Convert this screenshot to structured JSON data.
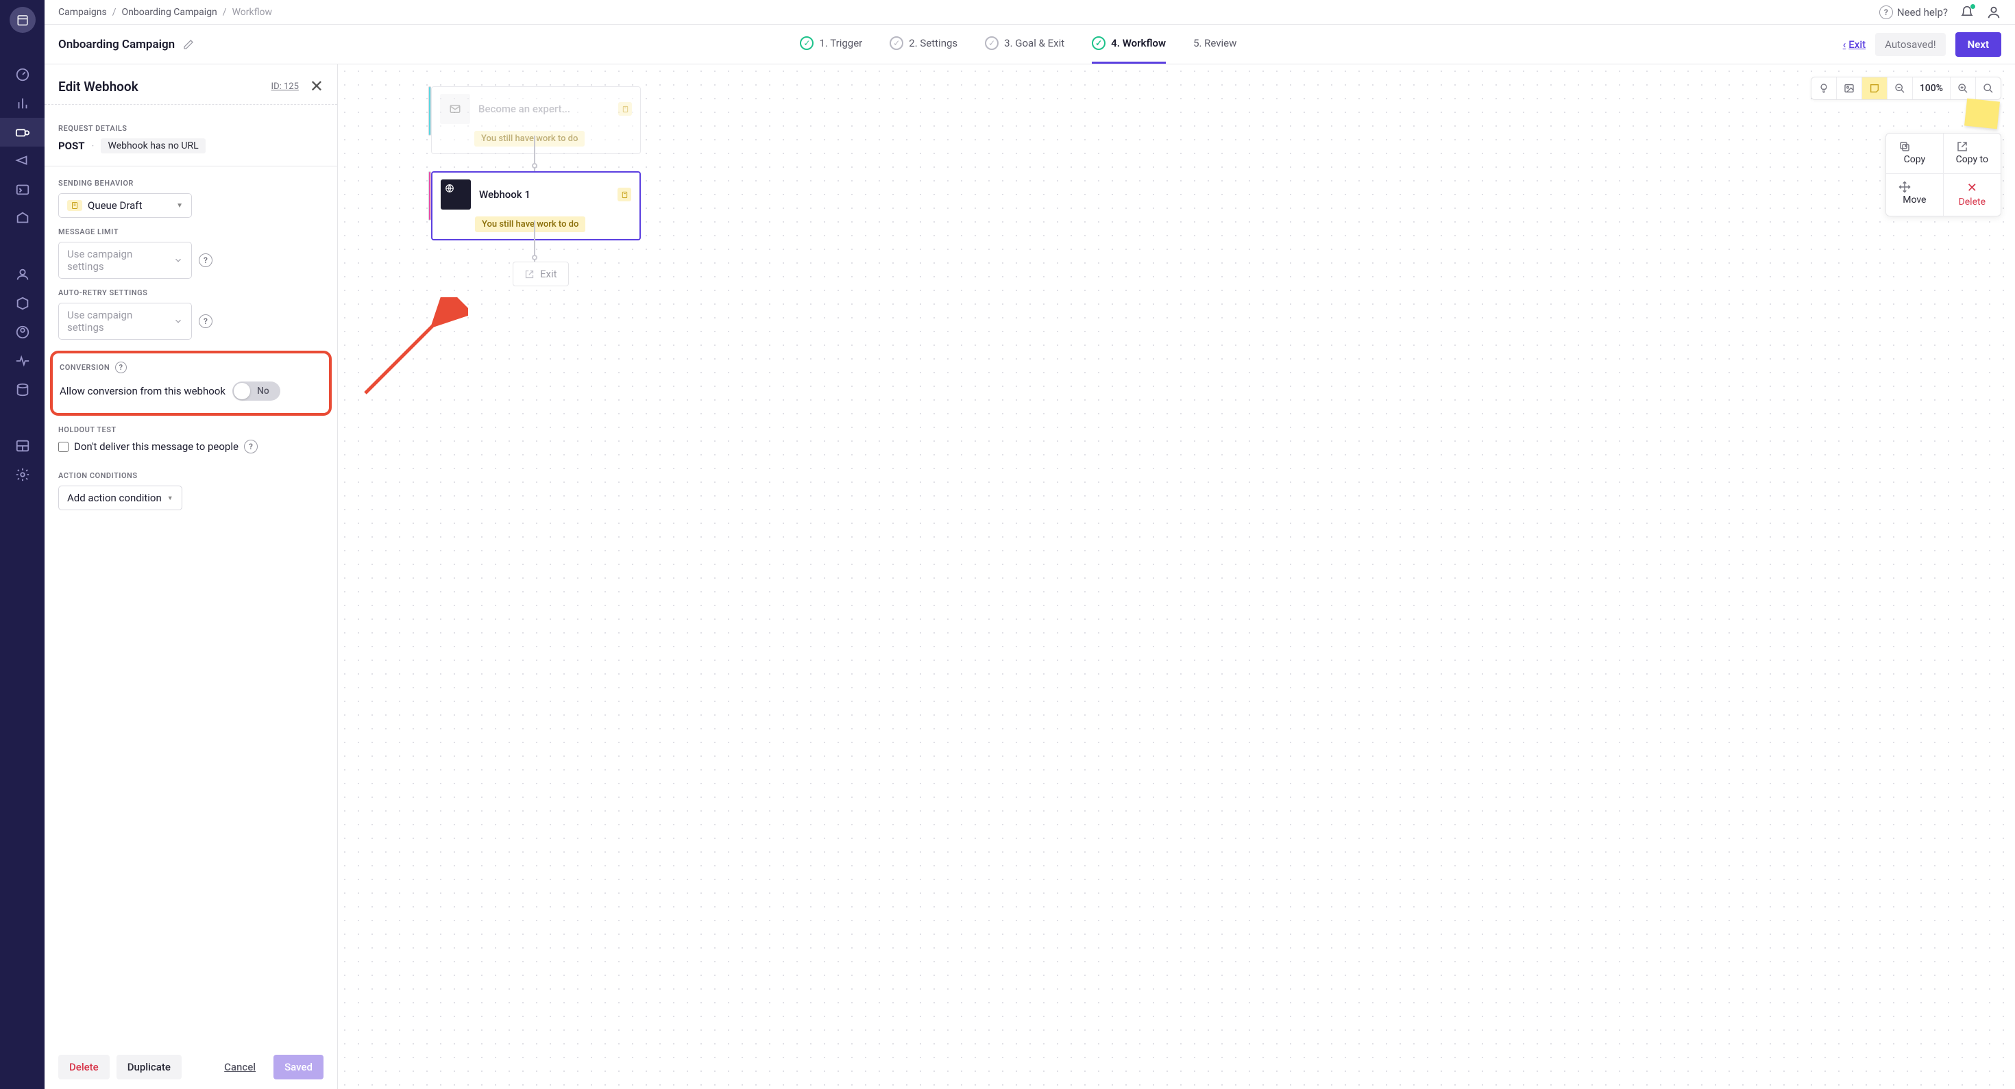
{
  "breadcrumb": {
    "a": "Campaigns",
    "b": "Onboarding Campaign",
    "c": "Workflow"
  },
  "topbar": {
    "help": "Need help?"
  },
  "header": {
    "title": "Onboarding Campaign",
    "steps": {
      "trigger": "1. Trigger",
      "settings": "2. Settings",
      "goal": "3. Goal & Exit",
      "workflow": "4. Workflow",
      "review": "5. Review"
    },
    "exit": "Exit",
    "autosaved": "Autosaved!",
    "next": "Next"
  },
  "panel": {
    "title": "Edit Webhook",
    "id": "ID: 125",
    "request_details": "REQUEST DETAILS",
    "method": "POST",
    "no_url": "Webhook has no URL",
    "sending_behavior": "SENDING BEHAVIOR",
    "queue_draft": "Queue Draft",
    "message_limit": "MESSAGE LIMIT",
    "use_campaign_ml": "Use campaign settings",
    "autoretry": "AUTO-RETRY SETTINGS",
    "use_campaign_ar": "Use campaign settings",
    "conversion": "CONVERSION",
    "allow_conversion": "Allow conversion from this webhook",
    "toggle_value": "No",
    "holdout": "HOLDOUT TEST",
    "holdout_check": "Don't deliver this message to people",
    "action_conditions": "ACTION CONDITIONS",
    "add_condition": "Add action condition",
    "footer": {
      "delete": "Delete",
      "duplicate": "Duplicate",
      "cancel": "Cancel",
      "saved": "Saved"
    }
  },
  "canvas": {
    "zoom": "100%",
    "email_title": "Become an expert...",
    "email_warn": "You still have work to do",
    "webhook_title": "Webhook 1",
    "webhook_warn": "You still have work to do",
    "exit": "Exit",
    "actions": {
      "copy": "Copy",
      "copyto": "Copy to",
      "move": "Move",
      "delete": "Delete"
    }
  }
}
